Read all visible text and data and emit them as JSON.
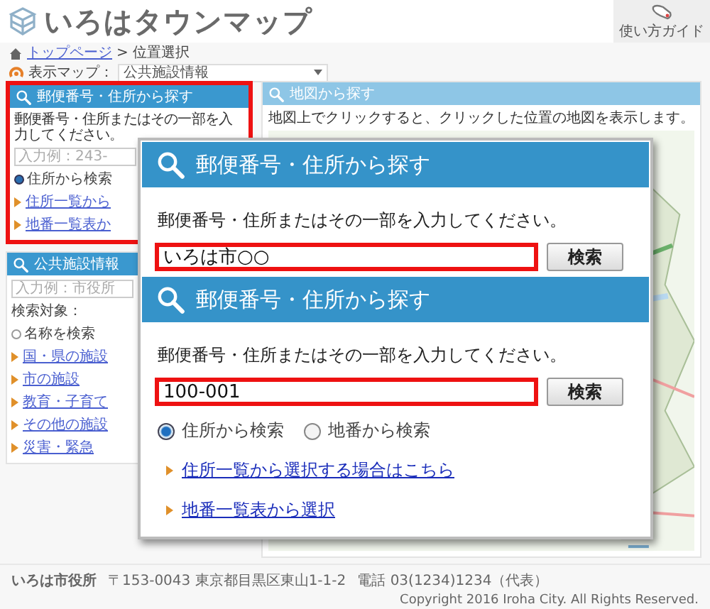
{
  "header": {
    "site_title": "いろはタウンマップ",
    "guide_button": "使い方ガイド"
  },
  "breadcrumb": {
    "link": "トップページ",
    "separator": ">",
    "current": "位置選択"
  },
  "map_selector": {
    "label": "表示マップ：",
    "value": "公共施設情報"
  },
  "address_search": {
    "title": "郵便番号・住所から探す",
    "highlighted": true,
    "instruction": "郵便番号・住所またはその一部を入力してください。",
    "placeholder": "入力例：243-",
    "radios": [
      {
        "label": "住所から検索",
        "selected": true
      }
    ],
    "links": [
      "住所一覧から",
      "地番一覧表か"
    ]
  },
  "public_search": {
    "title": "公共施設情報",
    "placeholder": "入力例：市役所",
    "target_label": "検索対象：",
    "radios": [
      {
        "label": "名称を検索",
        "selected": false
      }
    ],
    "links": [
      "国・県の施設",
      "市の施設",
      "教育・子育て",
      "その他の施設",
      "災害・緊急"
    ]
  },
  "map_panel": {
    "title": "地図から探す",
    "instruction": "地図上でクリックすると、クリックした位置の地図を表示します。"
  },
  "zoom_popup": {
    "sections": [
      {
        "title": "郵便番号・住所から探す",
        "instruction": "郵便番号・住所またはその一部を入力してください。",
        "input": {
          "value": "いろは市○○",
          "highlighted": true
        },
        "button": "検索"
      },
      {
        "title": "郵便番号・住所から探す",
        "instruction": "郵便番号・住所またはその一部を入力してください。",
        "input": {
          "value": "100-001",
          "highlighted": true
        },
        "button": "検索",
        "radios": [
          {
            "label": "住所から検索",
            "selected": true
          },
          {
            "label": "地番から検索",
            "selected": false
          }
        ],
        "links": [
          "住所一覧から選択する場合はこちら",
          "地番一覧表から選択"
        ]
      }
    ]
  },
  "footer": {
    "org": "いろは市役所",
    "address": "〒153-0043 東京都目黒区東山1-1-2",
    "phone": "電話 03(1234)1234（代表）",
    "copyright": "Copyright 2016 Iroha City. All Rights Reserved."
  }
}
